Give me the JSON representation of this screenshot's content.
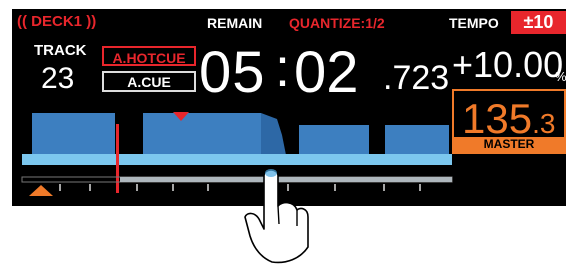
{
  "header": {
    "deck_label": "DECK1",
    "remain_label": "REMAIN",
    "quantize_label": "QUANTIZE:1/2",
    "tempo_label": "TEMPO",
    "tempo_range": "±10"
  },
  "track": {
    "label": "TRACK",
    "number": "23"
  },
  "badges": {
    "hotcue": "A.HOTCUE",
    "cue": "A.CUE"
  },
  "time": {
    "minutes": "05",
    "colon": ":",
    "seconds": "02",
    "milliseconds": ".723"
  },
  "pitch": {
    "value": "+10.00",
    "unit": "%"
  },
  "bpm": {
    "main": "135",
    "decimal": ".3",
    "status": "MASTER"
  },
  "colors": {
    "accent_red": "#e8262c",
    "accent_orange": "#f07a29",
    "waveform_blue": "#3d7fc0",
    "screen_bg": "#000000"
  },
  "icons": [
    "deck-bracket-icon",
    "playhead-marker-icon",
    "cue-triangle-icon",
    "finger-touch-icon"
  ]
}
